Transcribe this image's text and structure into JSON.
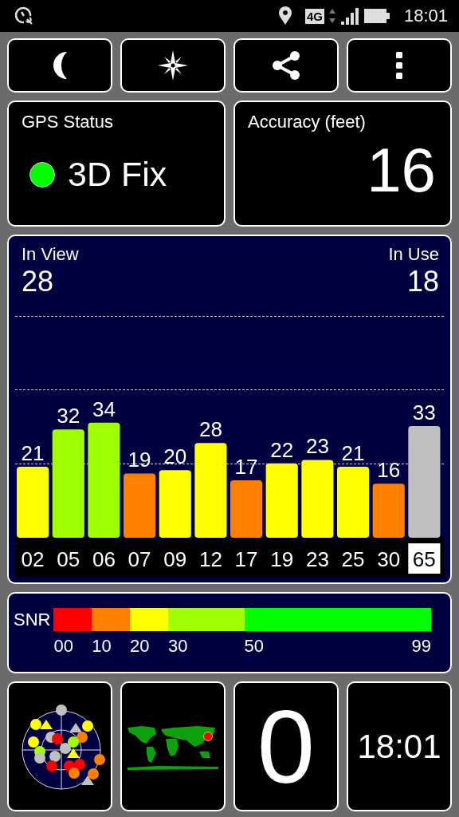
{
  "status_bar": {
    "network": "4G",
    "time": "18:01"
  },
  "toolbar": [
    {
      "kind": "night"
    },
    {
      "kind": "compass"
    },
    {
      "kind": "share"
    },
    {
      "kind": "menu"
    }
  ],
  "gps_status": {
    "label": "GPS Status",
    "fixed": true,
    "value": "3D Fix"
  },
  "accuracy": {
    "label": "Accuracy (feet)",
    "value": "16"
  },
  "satellites": {
    "in_view_label": "In View",
    "in_view": "28",
    "in_use_label": "In Use",
    "in_use": "18",
    "chart_data": {
      "type": "bar",
      "categories": [
        "02",
        "05",
        "06",
        "07",
        "09",
        "12",
        "17",
        "19",
        "23",
        "25",
        "30",
        "65"
      ],
      "series": [
        {
          "values": [
            21,
            32,
            34,
            19,
            20,
            28,
            17,
            22,
            23,
            21,
            16,
            33
          ]
        }
      ],
      "data_labels": true
    },
    "bars": [
      {
        "in_use": true
      },
      {
        "in_use": true
      },
      {
        "in_use": true
      },
      {
        "in_use": true
      },
      {
        "in_use": true
      },
      {
        "in_use": true
      },
      {
        "in_use": true
      },
      {
        "in_use": true
      },
      {
        "in_use": true
      },
      {
        "in_use": true
      },
      {
        "in_use": true
      },
      {
        "in_use": false
      }
    ]
  },
  "snr_scale": {
    "label": "SNR",
    "stops": [
      {
        "label": "00",
        "color": "#ff0000"
      },
      {
        "label": "10",
        "color": "#ff8000"
      },
      {
        "label": "20",
        "color": "#ffff00"
      },
      {
        "label": "30",
        "color": "#a0ff00"
      },
      {
        "label": "50",
        "color": "#00ff00"
      }
    ],
    "end": "99"
  },
  "tiles": {
    "count": "0",
    "clock": "18:01"
  }
}
